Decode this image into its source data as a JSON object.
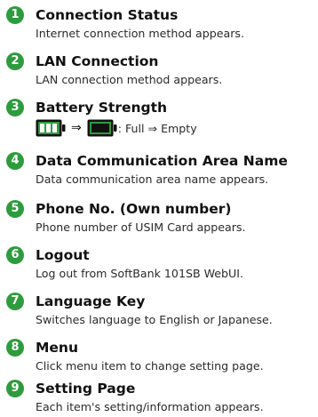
{
  "accent_color": "#2e9c3e",
  "items": [
    {
      "number": "1",
      "title": "Connection Status",
      "description": "Internet connection method appears."
    },
    {
      "number": "2",
      "title": "LAN Connection",
      "description": "LAN connection method appears."
    },
    {
      "number": "3",
      "title": "Battery Strength",
      "description": ""
    },
    {
      "number": "4",
      "title": "Data Communication Area Name",
      "description": "Data communication area name appears."
    },
    {
      "number": "5",
      "title": "Phone No. (Own number)",
      "description": "Phone number of USIM Card appears."
    },
    {
      "number": "6",
      "title": "Logout",
      "description": "Log out from SoftBank 101SB WebUI."
    },
    {
      "number": "7",
      "title": "Language Key",
      "description": "Switches language to English or Japanese."
    },
    {
      "number": "8",
      "title": "Menu",
      "description": "Click menu item to change setting page."
    },
    {
      "number": "9",
      "title": "Setting Page",
      "description": "Each item's setting/information appears."
    }
  ],
  "battery": {
    "full_icon": "battery-full-icon",
    "empty_icon": "battery-empty-icon",
    "arrow": "⇒",
    "text": ": Full ⇒ Empty"
  }
}
